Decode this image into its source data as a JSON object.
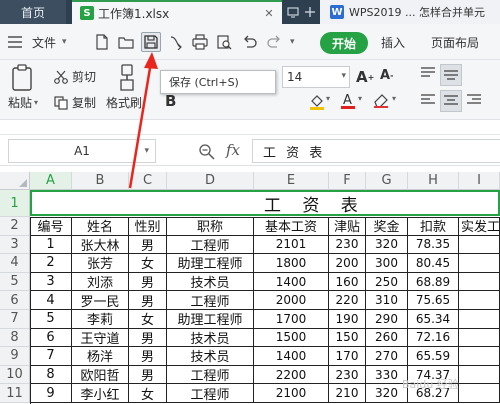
{
  "tabs": {
    "home_label": "首页",
    "doc_badge": "S",
    "doc_label": "工作簿1.xlsx",
    "doc_close": "✕",
    "other_badge": "W",
    "other_label": "WPS2019 ... 怎样合并单元"
  },
  "menubar": {
    "file_label": "文件",
    "tab_start": "开始",
    "tab_insert": "插入",
    "tab_page_layout": "页面布局"
  },
  "ribbon": {
    "cut_label": "剪切",
    "copy_label": "复制",
    "paste_label": "粘贴",
    "format_painter_label": "格式刷",
    "font_size": "14"
  },
  "tooltip": {
    "text": "保存 (Ctrl+S)"
  },
  "formula_bar": {
    "cell_ref": "A1",
    "fx_label": "fx",
    "content": "工 资 表"
  },
  "sheet": {
    "columns": [
      "A",
      "B",
      "C",
      "D",
      "E",
      "F",
      "G",
      "H",
      "I"
    ],
    "rows": [
      "1",
      "2",
      "3",
      "4",
      "5",
      "6",
      "7",
      "8",
      "9",
      "10",
      "11"
    ],
    "title": "工 资 表",
    "headers": [
      "编号",
      "姓名",
      "性别",
      "职称",
      "基本工资",
      "津贴",
      "奖金",
      "扣款",
      "实发工"
    ],
    "data": [
      [
        "1",
        "张大林",
        "男",
        "工程师",
        "2101",
        "230",
        "320",
        "78.35",
        ""
      ],
      [
        "2",
        "张芳",
        "女",
        "助理工程师",
        "1800",
        "200",
        "300",
        "80.45",
        ""
      ],
      [
        "3",
        "刘添",
        "男",
        "技术员",
        "1400",
        "160",
        "250",
        "68.89",
        ""
      ],
      [
        "4",
        "罗一民",
        "男",
        "工程师",
        "2000",
        "220",
        "310",
        "75.65",
        ""
      ],
      [
        "5",
        "李莉",
        "女",
        "助理工程师",
        "1700",
        "190",
        "290",
        "65.34",
        ""
      ],
      [
        "6",
        "王守道",
        "男",
        "技术员",
        "1500",
        "150",
        "260",
        "72.16",
        ""
      ],
      [
        "7",
        "杨洋",
        "男",
        "技术员",
        "1400",
        "170",
        "270",
        "65.59",
        ""
      ],
      [
        "8",
        "欧阳哲",
        "男",
        "工程师",
        "2200",
        "230",
        "330",
        "74.37",
        ""
      ],
      [
        "9",
        "李小红",
        "女",
        "工程师",
        "2100",
        "210",
        "320",
        "68.27",
        ""
      ]
    ]
  },
  "watermark": "Baidu 经验"
}
